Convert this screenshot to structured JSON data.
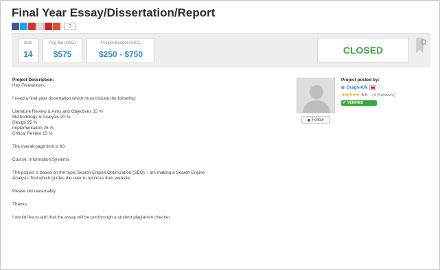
{
  "project": {
    "title": "Final Year Essay/Dissertation/Report"
  },
  "share": {
    "count": "0",
    "icons": [
      "facebook-icon",
      "twitter-icon",
      "gmail-icon",
      "print-icon",
      "pinterest-icon",
      "google-plus-icon"
    ]
  },
  "stats": {
    "bids_label": "Bids",
    "bids_value": "14",
    "avg_label": "Avg Bid (USD)",
    "avg_value": "$575",
    "budget_label": "Project Budget (USD)",
    "budget_value": "$250 - $750"
  },
  "status": {
    "label": "CLOSED",
    "color": "#3eaa3e"
  },
  "description": {
    "heading": "Project Description:",
    "greeting": "Hey Freelancers,",
    "intro": "I need a final year dissertation which must include the following:",
    "items": [
      "Literature Review & Aims and Objectives 15 %",
      "Methodology & Analysis 20 %",
      "Design 25 %",
      "Implementation 25 %",
      "Critical Review 15 %"
    ],
    "page_limit": "The overall page limit is 60.",
    "course": "Course: Information Systems",
    "topic_line1": "The project is based on the topic Search Engine Optimization (SEO). I am making a Search Engine",
    "topic_line2": "Analysis Tool which guides the user to optimize their website.",
    "bid_note": "Please bid reasonably.",
    "thanks": "Thanks.",
    "addendum": "I would like to add that the essay will be put through a student plagiarism checker."
  },
  "poster": {
    "heading": "Project posted by:",
    "name": "DragonUk",
    "rating": "5.0",
    "reviews": "(4 Reviews)",
    "verified_label": "VERIFIED",
    "follow_label": "Follow"
  },
  "colors": {
    "accent_blue": "#2a8bc9",
    "star": "#f2b01e",
    "verified_green": "#37a93a"
  }
}
